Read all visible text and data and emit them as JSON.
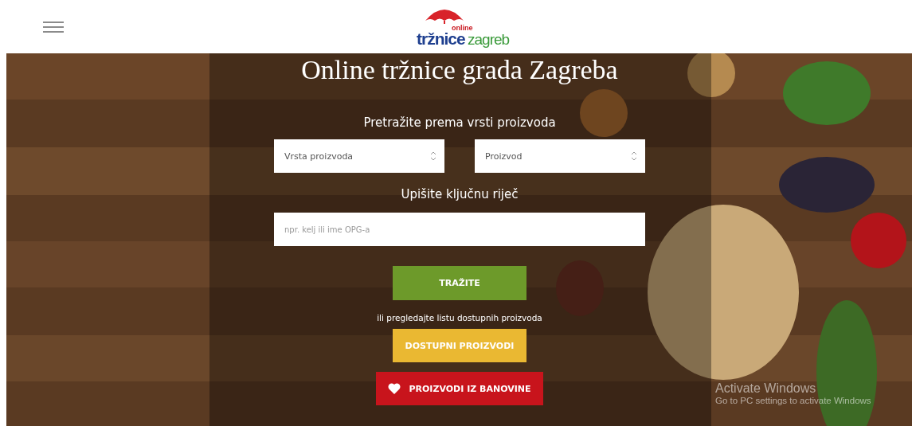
{
  "header": {
    "logo": {
      "small": "online",
      "main": "tržnice",
      "city": "zagreb"
    }
  },
  "hero": {
    "kind": "picture",
    "title": "Online tržnice grada Zagreba",
    "search_label": "Pretražite prema vrsti proizvoda",
    "selects": [
      {
        "placeholder": "Vrsta proizvoda"
      },
      {
        "placeholder": "Proizvod"
      }
    ],
    "keyword_label": "Upišite ključnu riječ",
    "keyword_field": {
      "placeholder": "npr. kelj ili ime OPG-a"
    },
    "search_button": "TRAŽITE",
    "browse_text": "ili pregledajte listu dostupnih proizvoda",
    "buttons": [
      {
        "label": "DOSTUPNI PROIZVODI",
        "kind": "plain",
        "color": "#eab832"
      },
      {
        "label": "PROIZVODI IZ BANOVINE",
        "kind": "heart",
        "color": "#c8141c"
      }
    ]
  },
  "os_notice": {
    "title": "Activate Windows",
    "text": "Go to PC settings to activate Windows"
  }
}
